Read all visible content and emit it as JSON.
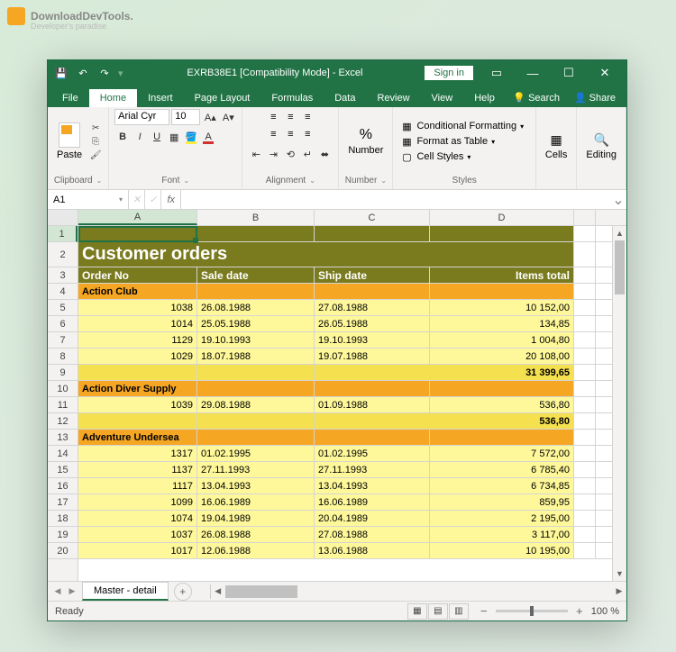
{
  "watermark": {
    "text": "DownloadDevTools.",
    "sub": "Developer's paradise"
  },
  "titlebar": {
    "app_title": "EXRB38E1  [Compatibility Mode]  -  Excel",
    "signin": "Sign in"
  },
  "tabs": {
    "file": "File",
    "home": "Home",
    "insert": "Insert",
    "page_layout": "Page Layout",
    "formulas": "Formulas",
    "data": "Data",
    "review": "Review",
    "view": "View",
    "help": "Help",
    "search": "Search",
    "share": "Share"
  },
  "ribbon": {
    "clipboard": {
      "label": "Clipboard",
      "paste": "Paste"
    },
    "font": {
      "label": "Font",
      "name": "Arial Cyr",
      "size": "10"
    },
    "alignment": {
      "label": "Alignment"
    },
    "number": {
      "label": "Number",
      "btn": "Number"
    },
    "styles": {
      "label": "Styles",
      "cond": "Conditional Formatting",
      "table": "Format as Table",
      "cell": "Cell Styles"
    },
    "cells": {
      "label": "Cells"
    },
    "editing": {
      "label": "Editing"
    }
  },
  "namebox": "A1",
  "fx": "fx",
  "columns": [
    "A",
    "B",
    "C",
    "D"
  ],
  "sheet": {
    "title": "Customer orders",
    "headers": {
      "order": "Order No",
      "sale": "Sale date",
      "ship": "Ship date",
      "total": "Items total"
    },
    "groups": [
      {
        "name": "Action Club",
        "rows": [
          [
            "1038",
            "26.08.1988",
            "27.08.1988",
            "10 152,00"
          ],
          [
            "1014",
            "25.05.1988",
            "26.05.1988",
            "134,85"
          ],
          [
            "1129",
            "19.10.1993",
            "19.10.1993",
            "1 004,80"
          ],
          [
            "1029",
            "18.07.1988",
            "19.07.1988",
            "20 108,00"
          ]
        ],
        "subtotal": "31 399,65"
      },
      {
        "name": "Action Diver Supply",
        "rows": [
          [
            "1039",
            "29.08.1988",
            "01.09.1988",
            "536,80"
          ]
        ],
        "subtotal": "536,80"
      },
      {
        "name": "Adventure Undersea",
        "rows": [
          [
            "1317",
            "01.02.1995",
            "01.02.1995",
            "7 572,00"
          ],
          [
            "1137",
            "27.11.1993",
            "27.11.1993",
            "6 785,40"
          ],
          [
            "1117",
            "13.04.1993",
            "13.04.1993",
            "6 734,85"
          ],
          [
            "1099",
            "16.06.1989",
            "16.06.1989",
            "859,95"
          ],
          [
            "1074",
            "19.04.1989",
            "20.04.1989",
            "2 195,00"
          ],
          [
            "1037",
            "26.08.1988",
            "27.08.1988",
            "3 117,00"
          ],
          [
            "1017",
            "12.06.1988",
            "13.06.1988",
            "10 195,00"
          ]
        ]
      }
    ]
  },
  "sheet_tab": "Master - detail",
  "status": {
    "ready": "Ready",
    "zoom": "100 %"
  }
}
